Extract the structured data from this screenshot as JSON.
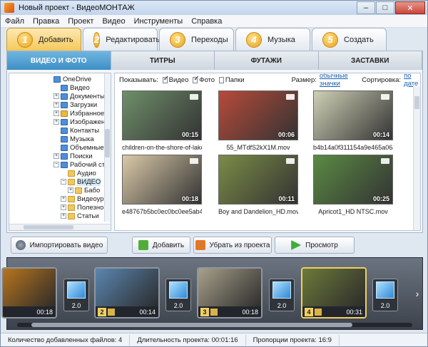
{
  "window": {
    "title": "Новый проект - ВидеоМОНТАЖ",
    "minimize": "–",
    "maximize": "□",
    "close": "✕"
  },
  "menu": [
    "Файл",
    "Правка",
    "Проект",
    "Видео",
    "Инструменты",
    "Справка"
  ],
  "steps": [
    {
      "num": "1",
      "label": "Добавить"
    },
    {
      "num": "2",
      "label": "Редактировать"
    },
    {
      "num": "3",
      "label": "Переходы"
    },
    {
      "num": "4",
      "label": "Музыка"
    },
    {
      "num": "5",
      "label": "Создать"
    }
  ],
  "subtabs": [
    "ВИДЕО И ФОТО",
    "ТИТРЫ",
    "ФУТАЖИ",
    "ЗАСТАВКИ"
  ],
  "tree": [
    "OneDrive",
    "Видео",
    "Документы",
    "Загрузки",
    "Избранное",
    "Изображения",
    "Контакты",
    "Музыка",
    "Объемные",
    "Поиски",
    "Рабочий ст",
    "Аудио",
    "ВИДЕО",
    "Бабо",
    "Видеоур",
    "Полезно",
    "Статьи"
  ],
  "filter": {
    "show_label": "Показывать:",
    "video": "Видео",
    "photo": "Фото",
    "folders": "Папки",
    "size_label": "Размер:",
    "size_value": "обычные значки",
    "sort_label": "Сортировка:",
    "sort_value": "по дате"
  },
  "files": [
    {
      "name": "children-on-the-shore-of-lake-XUQ...",
      "duration": "00:15",
      "color": "#6f8f6a"
    },
    {
      "name": "55_MTdfS2kX1M.mov",
      "duration": "00:06",
      "color": "#b84a3a"
    },
    {
      "name": "b4b14a0f311154a9e465a06a3b1e4c59.mov",
      "duration": "00:14",
      "color": "#cfd0b5"
    },
    {
      "name": "e48767b5bc0ec0bc0ee5ab497e20...",
      "duration": "00:18",
      "color": "#d9c9a8"
    },
    {
      "name": "Boy and Dandelion_HD.mov",
      "duration": "00:11",
      "color": "#7b8c47"
    },
    {
      "name": "Apricot1_HD NTSC.mov",
      "duration": "00:25",
      "color": "#5a8a43"
    }
  ],
  "buttons": {
    "import": "Импортировать видео",
    "add": "Добавить",
    "remove": "Убрать из проекта",
    "preview": "Просмотр"
  },
  "timeline": {
    "clips": [
      {
        "num": "1",
        "duration": "00:18",
        "color": "#b8741d"
      },
      {
        "num": "2",
        "duration": "00:14",
        "color": "#5b86b0"
      },
      {
        "num": "3",
        "duration": "00:18",
        "color": "#a8a08a"
      },
      {
        "num": "4",
        "duration": "00:31",
        "color": "#6d7a3a"
      }
    ],
    "transitions": [
      "2.0",
      "2.0",
      "2.0",
      "2.0"
    ]
  },
  "status": {
    "files_added": "Количество добавленных файлов: 4",
    "duration": "Длительность проекта: 00:01:16",
    "aspect": "Пропорции проекта: 16:9"
  }
}
